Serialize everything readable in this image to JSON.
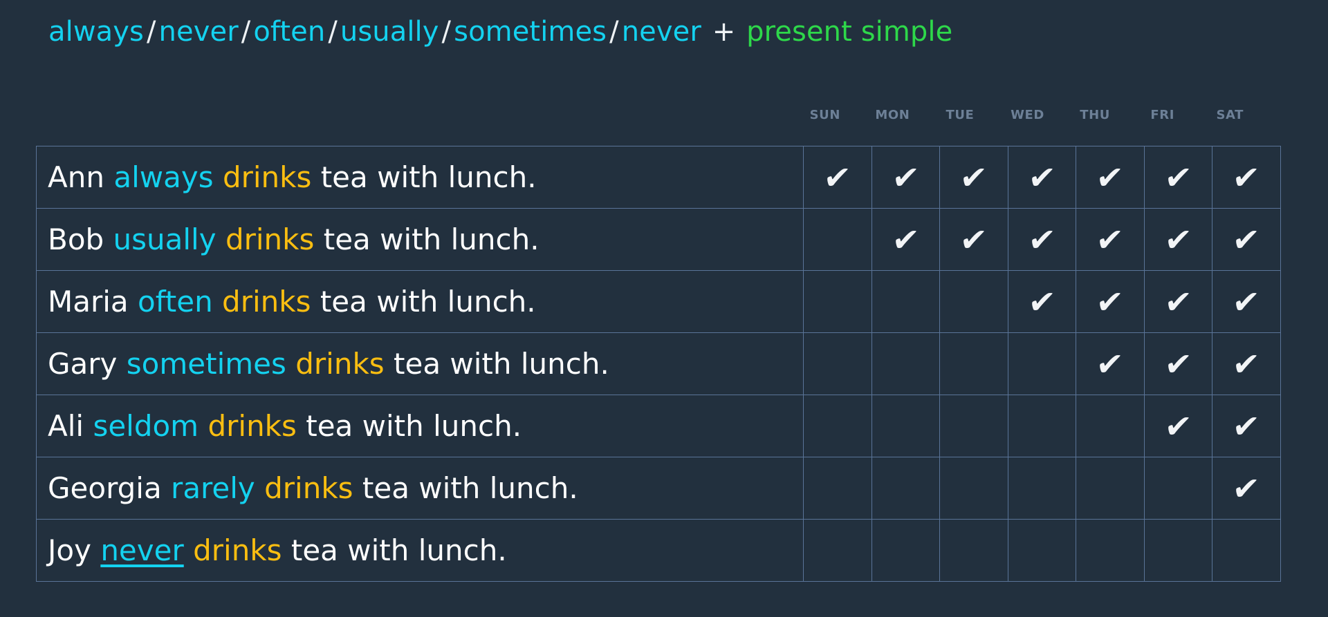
{
  "title": {
    "adverbs": [
      "always",
      "never",
      "often",
      "usually",
      "sometimes",
      "never"
    ],
    "separator": "/",
    "plus": "+",
    "tense": "present simple",
    "adverb_color": "#14d2f0",
    "separator_color": "#eef2f5",
    "tense_color": "#2ed84a"
  },
  "theme": {
    "background": "#22303e",
    "border": "#5a7498",
    "day_header_color": "#6d8097",
    "verb_color": "#fbbe11",
    "text_color": "#ffffff",
    "check_color": "#f2f4f6"
  },
  "days": [
    "SUN",
    "MON",
    "TUE",
    "WED",
    "THU",
    "FRI",
    "SAT"
  ],
  "check_glyph": "✔",
  "rows": [
    {
      "name": "Ann",
      "adverb": "always",
      "adverb_underlined": false,
      "verb": "drinks",
      "rest": "tea with lunch.",
      "checks": [
        true,
        true,
        true,
        true,
        true,
        true,
        true
      ],
      "check_count": 7
    },
    {
      "name": "Bob",
      "adverb": "usually",
      "adverb_underlined": false,
      "verb": "drinks",
      "rest": "tea with lunch.",
      "checks": [
        false,
        true,
        true,
        true,
        true,
        true,
        true
      ],
      "check_count": 6
    },
    {
      "name": "Maria",
      "adverb": "often",
      "adverb_underlined": false,
      "verb": "drinks",
      "rest": "tea with lunch.",
      "checks": [
        false,
        false,
        false,
        true,
        true,
        true,
        true
      ],
      "check_count": 4
    },
    {
      "name": "Gary",
      "adverb": "sometimes",
      "adverb_underlined": false,
      "verb": "drinks",
      "rest": "tea with lunch.",
      "checks": [
        false,
        false,
        false,
        false,
        true,
        true,
        true
      ],
      "check_count": 3
    },
    {
      "name": "Ali",
      "adverb": "seldom",
      "adverb_underlined": false,
      "verb": "drinks",
      "rest": "tea with lunch.",
      "checks": [
        false,
        false,
        false,
        false,
        false,
        true,
        true
      ],
      "check_count": 2
    },
    {
      "name": "Georgia",
      "adverb": "rarely",
      "adverb_underlined": false,
      "verb": "drinks",
      "rest": "tea with lunch.",
      "checks": [
        false,
        false,
        false,
        false,
        false,
        false,
        true
      ],
      "check_count": 1
    },
    {
      "name": "Joy",
      "adverb": "never",
      "adverb_underlined": true,
      "verb": "drinks",
      "rest": "tea with lunch.",
      "checks": [
        false,
        false,
        false,
        false,
        false,
        false,
        false
      ],
      "check_count": 0
    }
  ]
}
